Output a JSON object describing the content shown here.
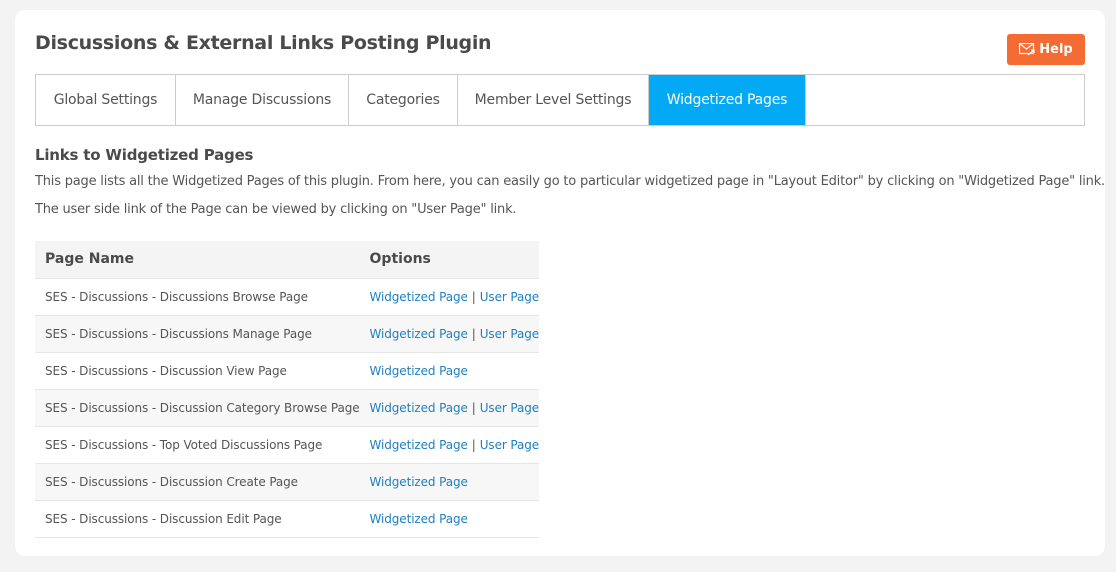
{
  "header": {
    "title": "Discussions & External Links Posting Plugin",
    "help_label": "Help",
    "help_icon": "mail-send-icon",
    "help_color": "#f46b34"
  },
  "tabs": [
    {
      "label": "Global Settings",
      "active": false
    },
    {
      "label": "Manage Discussions",
      "active": false
    },
    {
      "label": "Categories",
      "active": false
    },
    {
      "label": "Member Level Settings",
      "active": false
    },
    {
      "label": "Widgetized Pages",
      "active": true
    }
  ],
  "active_tab_color": "#03a9f4",
  "section": {
    "title": "Links to Widgetized Pages",
    "description_1": "This page lists all the Widgetized Pages of this plugin. From here, you can easily go to particular widgetized page in \"Layout Editor\" by clicking on \"Widgetized Page\" link.",
    "description_2": "The user side link of the Page can be viewed by clicking on \"User Page\" link."
  },
  "table": {
    "columns": [
      "Page Name",
      "Options"
    ],
    "separator": "|",
    "rows": [
      {
        "name": "SES - Discussions - Discussions Browse Page",
        "widgetized": "Widgetized Page",
        "user": "User Page"
      },
      {
        "name": "SES - Discussions - Discussions Manage Page",
        "widgetized": "Widgetized Page",
        "user": "User Page"
      },
      {
        "name": "SES - Discussions - Discussion View Page",
        "widgetized": "Widgetized Page",
        "user": null
      },
      {
        "name": "SES - Discussions - Discussion Category Browse Page",
        "widgetized": "Widgetized Page",
        "user": "User Page"
      },
      {
        "name": "SES - Discussions - Top Voted Discussions Page",
        "widgetized": "Widgetized Page",
        "user": "User Page"
      },
      {
        "name": "SES - Discussions - Discussion Create Page",
        "widgetized": "Widgetized Page",
        "user": null
      },
      {
        "name": "SES - Discussions - Discussion Edit Page",
        "widgetized": "Widgetized Page",
        "user": null
      }
    ]
  }
}
